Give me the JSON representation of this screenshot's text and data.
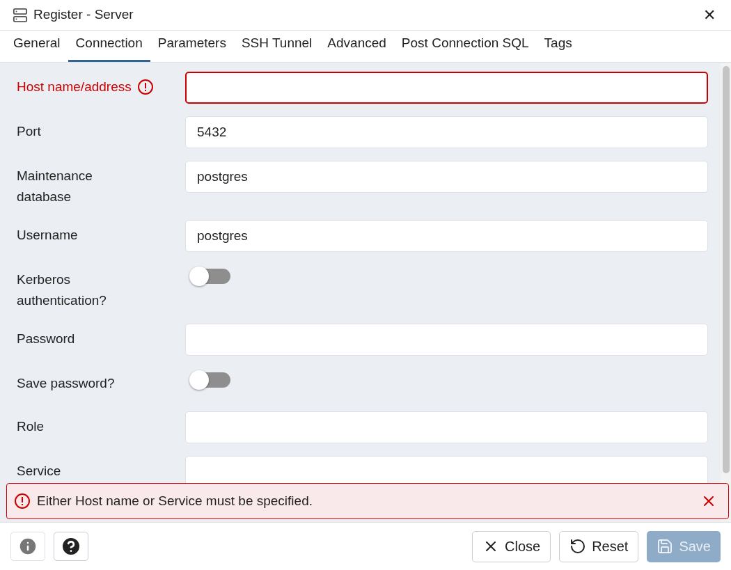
{
  "window": {
    "title": "Register - Server",
    "close": "✕"
  },
  "tabs": [
    {
      "label": "General",
      "selected": false
    },
    {
      "label": "Connection",
      "selected": true
    },
    {
      "label": "Parameters",
      "selected": false
    },
    {
      "label": "SSH Tunnel",
      "selected": false
    },
    {
      "label": "Advanced",
      "selected": false
    },
    {
      "label": "Post Connection SQL",
      "selected": false
    },
    {
      "label": "Tags",
      "selected": false
    }
  ],
  "fields": [
    {
      "kind": "text",
      "label": "Host name/address",
      "error": true
    },
    {
      "kind": "text",
      "label": "Port",
      "value": "5432",
      "error": false
    },
    {
      "kind": "text",
      "label": "Maintenance database",
      "value": "postgres",
      "error": false
    },
    {
      "kind": "text",
      "label": "Username",
      "value": "postgres",
      "error": false
    },
    {
      "kind": "switch",
      "label": "Kerberos authentication?",
      "on": false
    },
    {
      "kind": "text",
      "label": "Password",
      "error": false
    },
    {
      "kind": "switch",
      "label": "Save password?",
      "on": false
    },
    {
      "kind": "text",
      "label": "Role",
      "error": false
    },
    {
      "kind": "text",
      "label": "Service",
      "error": false
    }
  ],
  "error_banner": {
    "message": "Either Host name or Service must be specified."
  },
  "footer": {
    "buttons": [
      {
        "kind": "close",
        "label": "Close",
        "disabled": false
      },
      {
        "kind": "reset",
        "label": "Reset",
        "disabled": false
      },
      {
        "kind": "save",
        "label": "Save",
        "disabled": true
      }
    ]
  }
}
